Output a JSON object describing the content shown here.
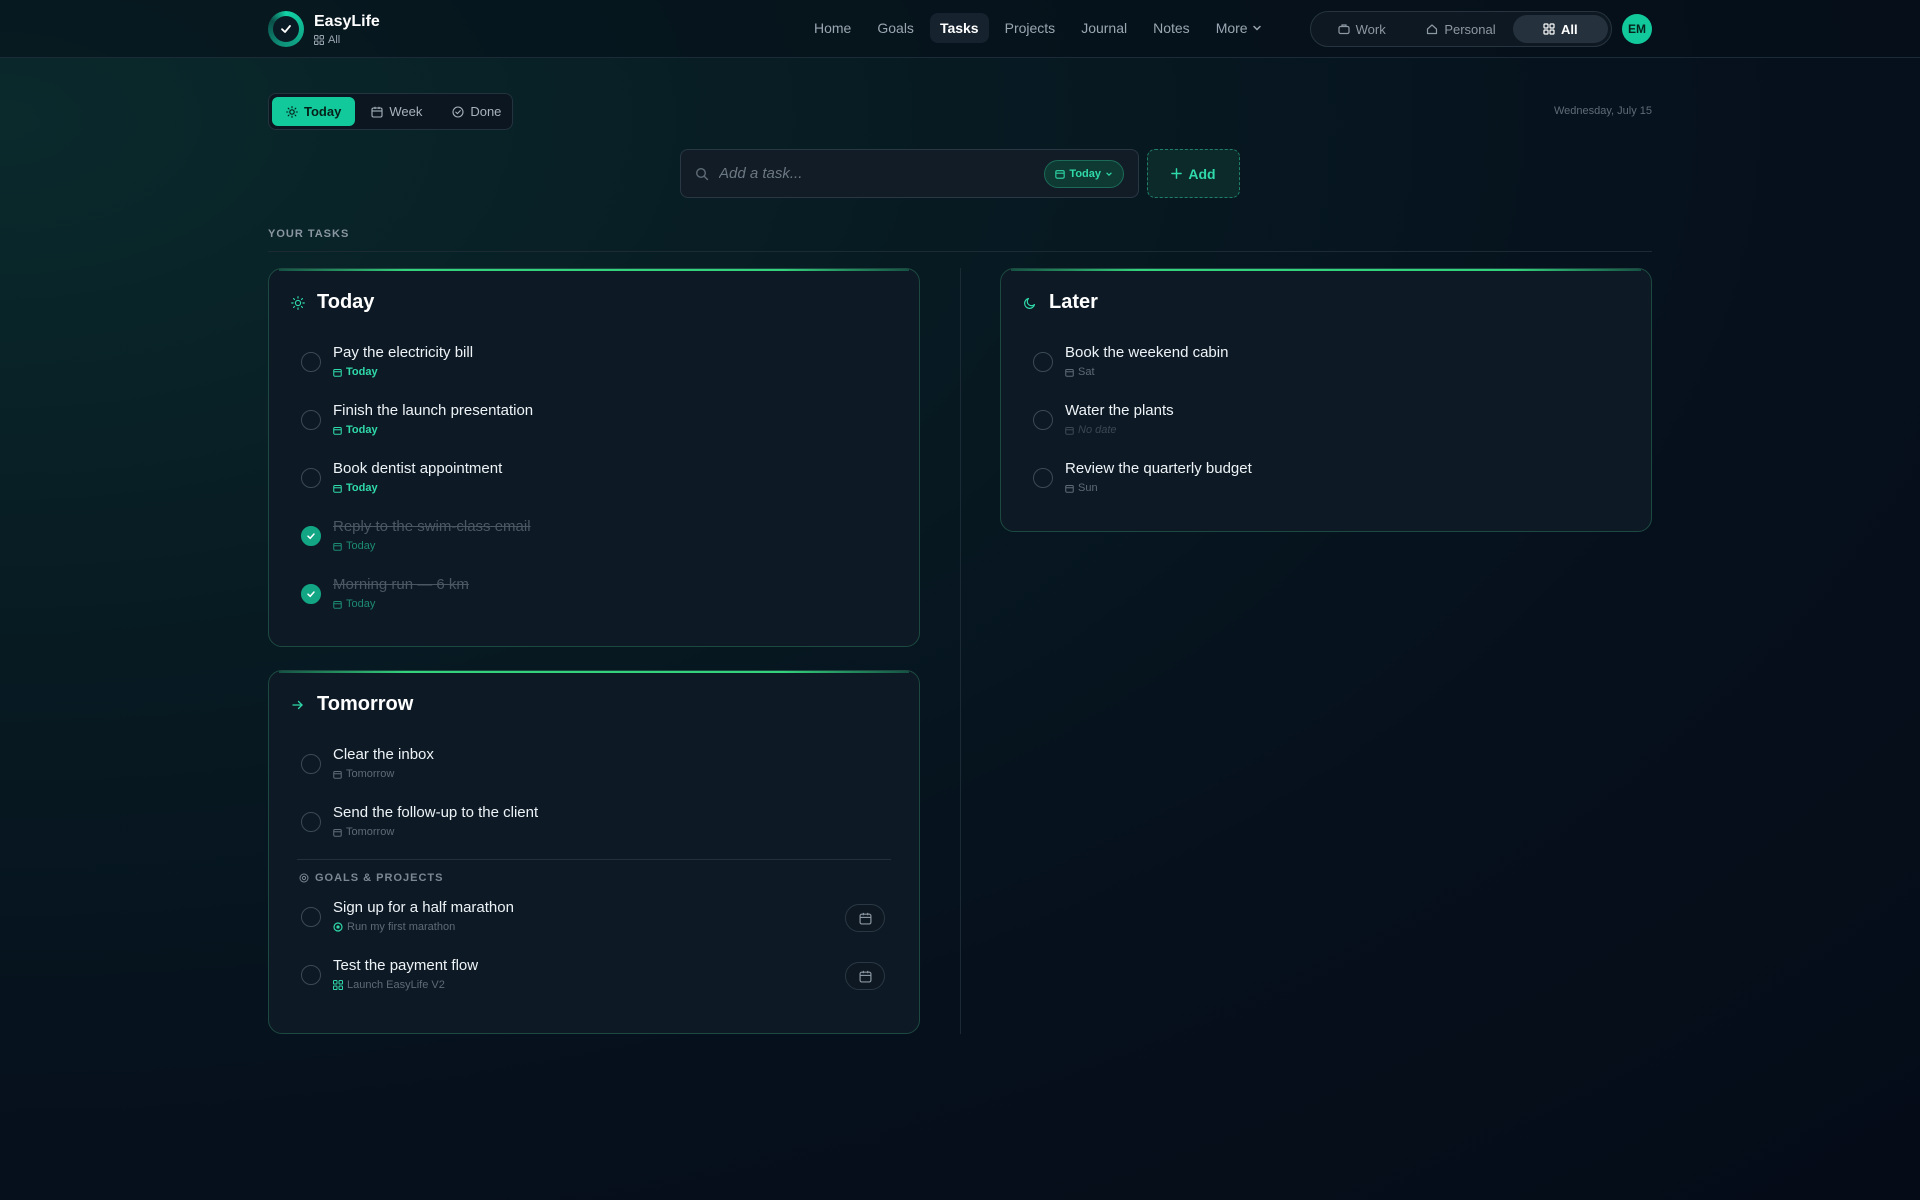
{
  "app": {
    "name": "EasyLife",
    "context_label": "All",
    "avatar_initials": "EM"
  },
  "nav": {
    "items": [
      {
        "label": "Home"
      },
      {
        "label": "Goals"
      },
      {
        "label": "Tasks",
        "active": true
      },
      {
        "label": "Projects"
      },
      {
        "label": "Journal"
      },
      {
        "label": "Notes"
      },
      {
        "label": "More"
      }
    ]
  },
  "context_switch": {
    "items": [
      {
        "label": "Work",
        "icon": "briefcase-icon"
      },
      {
        "label": "Personal",
        "icon": "home-icon"
      },
      {
        "label": "All",
        "icon": "grid-icon",
        "active": true
      }
    ]
  },
  "view_tabs": {
    "items": [
      {
        "label": "Today",
        "icon": "sun-icon",
        "active": true
      },
      {
        "label": "Week",
        "icon": "calendar-icon"
      },
      {
        "label": "Done",
        "icon": "check-circle-icon"
      }
    ]
  },
  "date_label": "Wednesday, July 15",
  "add_task": {
    "placeholder": "Add a task...",
    "due_label": "Today",
    "button_label": "Add"
  },
  "section_label": "YOUR TASKS",
  "colors": {
    "accent": "#12c99c",
    "accent_text": "#2fd9a9",
    "card_border": "#1d4a40",
    "card_top_glow": "#34d27c",
    "background": "#060f1c"
  },
  "cards": {
    "today": {
      "title": "Today",
      "icon": "sun-icon",
      "tasks": [
        {
          "title": "Pay the electricity bill",
          "due": "Today",
          "done": false
        },
        {
          "title": "Finish the launch presentation",
          "due": "Today",
          "done": false
        },
        {
          "title": "Book dentist appointment",
          "due": "Today",
          "done": false
        },
        {
          "title": "Reply to the swim-class email",
          "due": "Today",
          "done": true
        },
        {
          "title": "Morning run — 6 km",
          "due": "Today",
          "done": true
        }
      ]
    },
    "tomorrow": {
      "title": "Tomorrow",
      "icon": "arrow-right-icon",
      "tasks": [
        {
          "title": "Clear the inbox",
          "due": "Tomorrow"
        },
        {
          "title": "Send the follow-up to the client",
          "due": "Tomorrow"
        }
      ],
      "goals_label": "GOALS & PROJECTS",
      "goal_tasks": [
        {
          "title": "Sign up for a half marathon",
          "source": "Run my first marathon",
          "source_icon": "target-icon"
        },
        {
          "title": "Test the payment flow",
          "source": "Launch EasyLife V2",
          "source_icon": "grid-icon"
        }
      ]
    },
    "later": {
      "title": "Later",
      "icon": "moon-icon",
      "tasks": [
        {
          "title": "Book the weekend cabin",
          "due": "Sat"
        },
        {
          "title": "Water the plants",
          "due": "No date"
        },
        {
          "title": "Review the quarterly budget",
          "due": "Sun"
        }
      ]
    }
  }
}
